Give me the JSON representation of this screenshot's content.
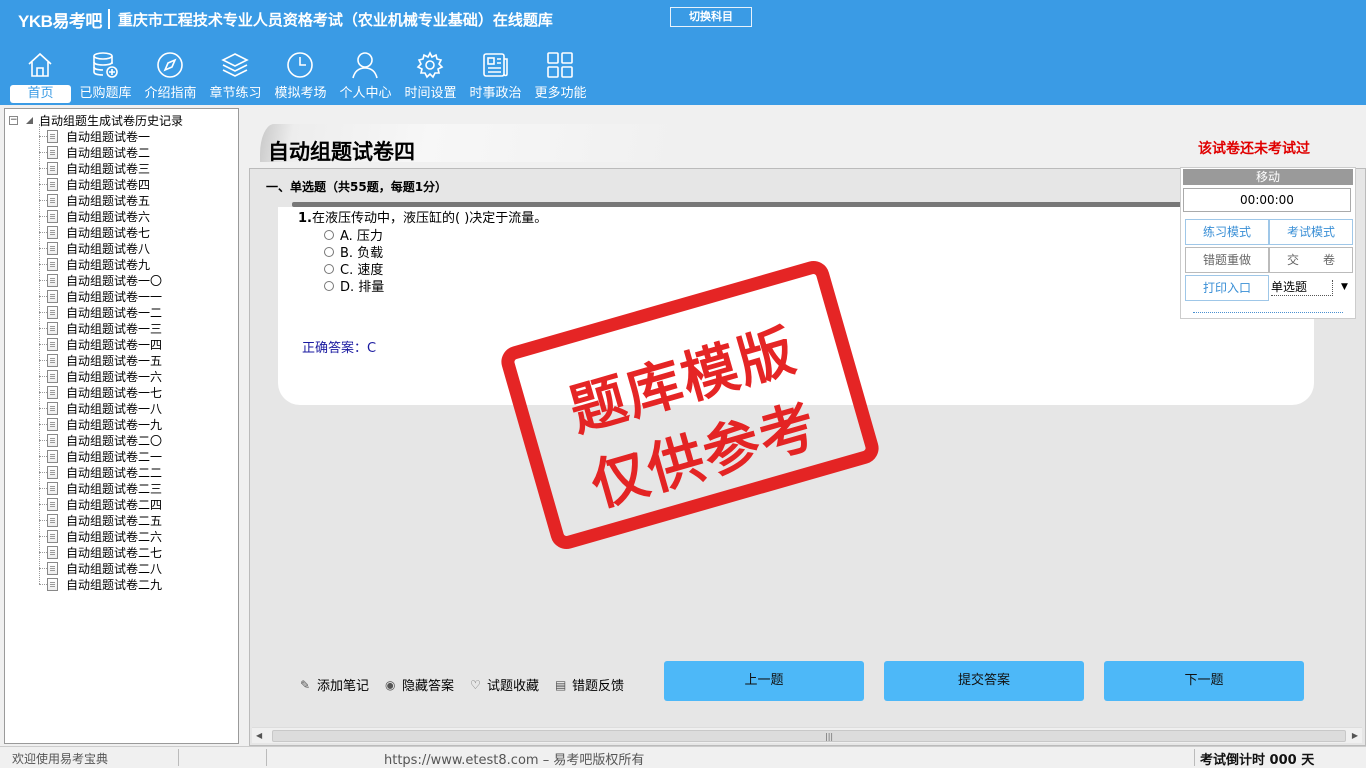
{
  "header": {
    "logo": "YKB易考吧",
    "title": "重庆市工程技术专业人员资格考试（农业机械专业基础）在线题库",
    "switch_subject": "切换科目",
    "nav": [
      {
        "label": "首页",
        "icon": "home-icon"
      },
      {
        "label": "已购题库",
        "icon": "database-icon"
      },
      {
        "label": "介绍指南",
        "icon": "compass-icon"
      },
      {
        "label": "章节练习",
        "icon": "layers-icon"
      },
      {
        "label": "模拟考场",
        "icon": "clock-icon"
      },
      {
        "label": "个人中心",
        "icon": "user-icon"
      },
      {
        "label": "时间设置",
        "icon": "gear-icon"
      },
      {
        "label": "时事政治",
        "icon": "news-icon"
      },
      {
        "label": "更多功能",
        "icon": "grid-icon"
      }
    ]
  },
  "sidebar": {
    "root": "自动组题生成试卷历史记录",
    "items": [
      "自动组题试卷一",
      "自动组题试卷二",
      "自动组题试卷三",
      "自动组题试卷四",
      "自动组题试卷五",
      "自动组题试卷六",
      "自动组题试卷七",
      "自动组题试卷八",
      "自动组题试卷九",
      "自动组题试卷一〇",
      "自动组题试卷一一",
      "自动组题试卷一二",
      "自动组题试卷一三",
      "自动组题试卷一四",
      "自动组题试卷一五",
      "自动组题试卷一六",
      "自动组题试卷一七",
      "自动组题试卷一八",
      "自动组题试卷一九",
      "自动组题试卷二〇",
      "自动组题试卷二一",
      "自动组题试卷二二",
      "自动组题试卷二三",
      "自动组题试卷二四",
      "自动组题试卷二五",
      "自动组题试卷二六",
      "自动组题试卷二七",
      "自动组题试卷二八",
      "自动组题试卷二九"
    ]
  },
  "main": {
    "paper_title": "自动组题试卷四",
    "exam_status": "该试卷还未考试过",
    "section_heading": "一、单选题（共55题，每题1分）",
    "question": {
      "number": "1.",
      "text": "在液压传动中，液压缸的( )决定于流量。",
      "options": [
        "A. 压力",
        "B. 负载",
        "C. 速度",
        "D. 排量"
      ],
      "answer_label": "正确答案：",
      "answer_value": "C"
    },
    "stamp": {
      "line1": "题库模版",
      "line2": "仅供参考"
    },
    "tools": [
      "添加笔记",
      "隐藏答案",
      "试题收藏",
      "错题反馈"
    ],
    "buttons": {
      "prev": "上一题",
      "submit": "提交答案",
      "next": "下一题"
    }
  },
  "panel": {
    "move": "移动",
    "timer": "00:00:00",
    "practice_mode": "练习模式",
    "exam_mode": "考试模式",
    "redo_wrong": "错题重做",
    "hand_in": "交　　卷",
    "print": "打印入口",
    "question_type": "单选题"
  },
  "status": {
    "welcome": "欢迎使用易考宝典",
    "copyright": "https://www.etest8.com – 易考吧版权所有",
    "countdown": "考试倒计时 000 天"
  },
  "colors": {
    "header_bg": "#3a9be5",
    "button_blue": "#4db8f8",
    "status_red": "#e00000",
    "stamp_red": "#e41a1a"
  }
}
